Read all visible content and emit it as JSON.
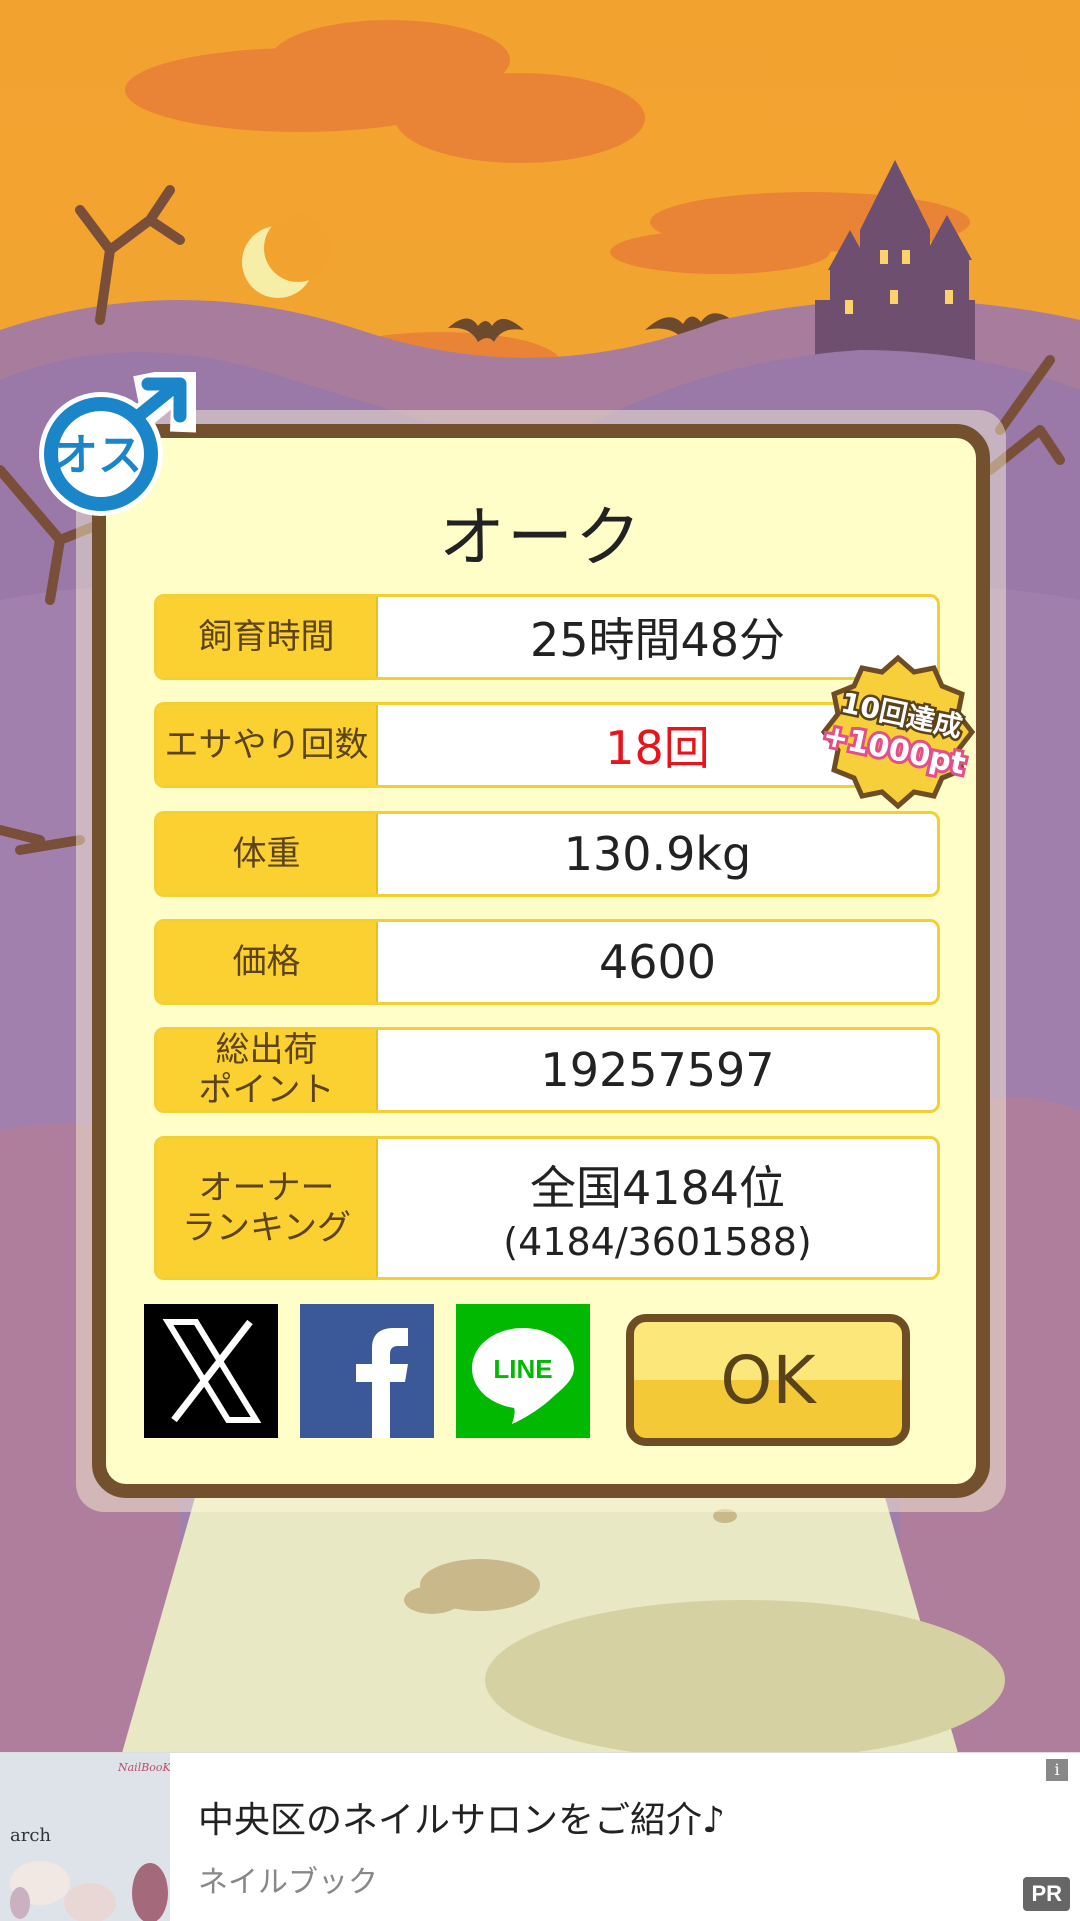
{
  "dialog": {
    "title": "オーク",
    "rows": [
      {
        "label": "飼育時間",
        "value": "25時間48分",
        "sub": ""
      },
      {
        "label": "エサやり回数",
        "value": "18回",
        "sub": ""
      },
      {
        "label": "体重",
        "value": "130.9kg",
        "sub": ""
      },
      {
        "label": "価格",
        "value": "4600",
        "sub": ""
      },
      {
        "label": "総出荷\nポイント",
        "value": "19257597",
        "sub": ""
      },
      {
        "label": "オーナー\nランキング",
        "value": "全国4184位",
        "sub": "(4184/3601588)"
      }
    ],
    "gender_label": "オス",
    "badge": {
      "line1": "10回達成",
      "line2": "+1000pt"
    },
    "ok_label": "OK",
    "share": {
      "x_label": "X",
      "facebook_label": "f",
      "line_label": "LINE"
    }
  },
  "ad": {
    "title": "中央区のネイルサロンをご紹介♪",
    "subtitle": "ネイルブック",
    "info": "i",
    "pr": "PR",
    "thumb_brand": "arch",
    "thumb_logo": "NailBooK"
  },
  "colors": {
    "sky": "#f3a531",
    "cloud": "#e98436",
    "hill": "#9c7cab",
    "dialog_bg": "#fffdc8",
    "dialog_border": "#73512f",
    "label_bg": "#fad131",
    "highlight_red": "#e8141c"
  }
}
